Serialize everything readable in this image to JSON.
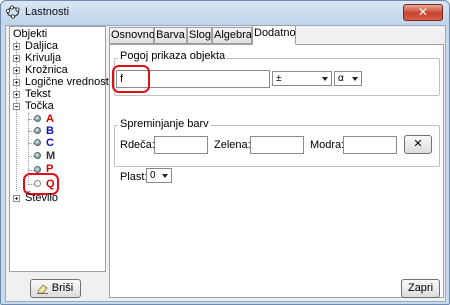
{
  "window": {
    "title": "Lastnosti",
    "close_glyph": "✕"
  },
  "tree": {
    "root": "Objekti",
    "items": [
      "Daljica",
      "Krivulja",
      "Krožnica",
      "Logične vrednosti",
      "Tekst",
      "Točka"
    ],
    "points": [
      {
        "label": "A",
        "color": "red"
      },
      {
        "label": "B",
        "color": "blue"
      },
      {
        "label": "C",
        "color": "blue"
      },
      {
        "label": "M",
        "color": "dark"
      },
      {
        "label": "P",
        "color": "red"
      },
      {
        "label": "Q",
        "color": "red"
      }
    ],
    "last": "Število"
  },
  "tabs": [
    "Osnovno",
    "Barva",
    "Slog",
    "Algebra",
    "Dodatno"
  ],
  "active_tab": "Dodatno",
  "display_group": {
    "title": "Pogoj prikaza objekta",
    "condition_value": "f",
    "combo1": "±",
    "combo2": "α"
  },
  "color_group": {
    "title": "Spreminjanje barv",
    "red_label": "Rdeča:",
    "green_label": "Zelena:",
    "blue_label": "Modra:",
    "red_value": "",
    "green_value": "",
    "blue_value": "",
    "clear_glyph": "✕"
  },
  "layer": {
    "label": "Plast:",
    "value": "0"
  },
  "buttons": {
    "delete": "Briši",
    "close": "Zapri"
  },
  "colors": {
    "highlight": "#e0101a",
    "title_bar": "#c9d9ec",
    "close_button": "#c7432f"
  }
}
